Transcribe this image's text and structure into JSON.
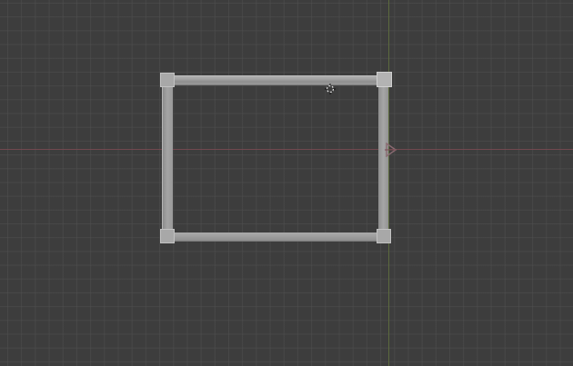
{
  "viewport": {
    "background_color": "#3d3d3d",
    "grid_color": "#505050",
    "axis_x_color": "#7a4a52",
    "axis_y_color": "#5f6e3e"
  },
  "object": {
    "name": "frame",
    "color": "#9c9c9c"
  },
  "icons": {
    "cursor": "3d-cursor-icon",
    "origin": "origin-arrow-icon"
  }
}
